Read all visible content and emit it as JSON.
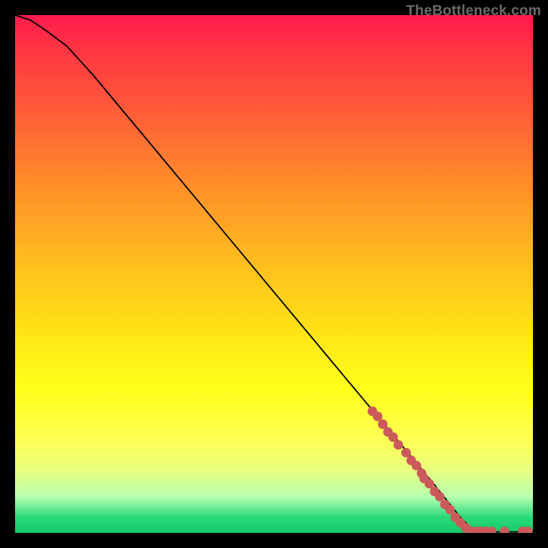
{
  "watermark": "TheBottleneck.com",
  "chart_data": {
    "type": "line",
    "title": "",
    "xlabel": "",
    "ylabel": "",
    "xlim": [
      0,
      100
    ],
    "ylim": [
      0,
      100
    ],
    "grid": false,
    "legend": false,
    "series": [
      {
        "name": "curve",
        "color": "#000000",
        "x": [
          0,
          3,
          6,
          10,
          15,
          20,
          25,
          30,
          35,
          40,
          45,
          50,
          55,
          60,
          65,
          70,
          75,
          80,
          82,
          84,
          86,
          88,
          90,
          92,
          94,
          96,
          98,
          100
        ],
        "y": [
          100,
          99,
          97,
          94,
          88.5,
          82.5,
          76.5,
          70.5,
          64.5,
          58.5,
          52.5,
          46.5,
          40.5,
          34.5,
          28.5,
          22.5,
          16.5,
          10.5,
          8,
          5.5,
          3,
          1,
          0.2,
          0.2,
          0.2,
          0.2,
          0.2,
          0.2
        ]
      }
    ],
    "markers": {
      "name": "highlight-dots",
      "color": "#cc5a5a",
      "radius_px": 7,
      "points": [
        {
          "x": 69,
          "y": 23.5
        },
        {
          "x": 70,
          "y": 22.5
        },
        {
          "x": 71,
          "y": 21
        },
        {
          "x": 72,
          "y": 19.5
        },
        {
          "x": 73,
          "y": 18.5
        },
        {
          "x": 74,
          "y": 17
        },
        {
          "x": 75.5,
          "y": 15.5
        },
        {
          "x": 76.5,
          "y": 14
        },
        {
          "x": 77.5,
          "y": 13
        },
        {
          "x": 78.5,
          "y": 11.5
        },
        {
          "x": 79,
          "y": 10.5
        },
        {
          "x": 80,
          "y": 9.5
        },
        {
          "x": 81,
          "y": 8
        },
        {
          "x": 82,
          "y": 7
        },
        {
          "x": 83,
          "y": 5.5
        },
        {
          "x": 84,
          "y": 4.5
        },
        {
          "x": 85,
          "y": 3
        },
        {
          "x": 86,
          "y": 2
        },
        {
          "x": 87,
          "y": 1
        },
        {
          "x": 88,
          "y": 0.3
        },
        {
          "x": 89,
          "y": 0.3
        },
        {
          "x": 90,
          "y": 0.3
        },
        {
          "x": 91,
          "y": 0.3
        },
        {
          "x": 92,
          "y": 0.3
        },
        {
          "x": 94.5,
          "y": 0.3
        },
        {
          "x": 98,
          "y": 0.3
        },
        {
          "x": 99,
          "y": 0.3
        }
      ]
    }
  }
}
